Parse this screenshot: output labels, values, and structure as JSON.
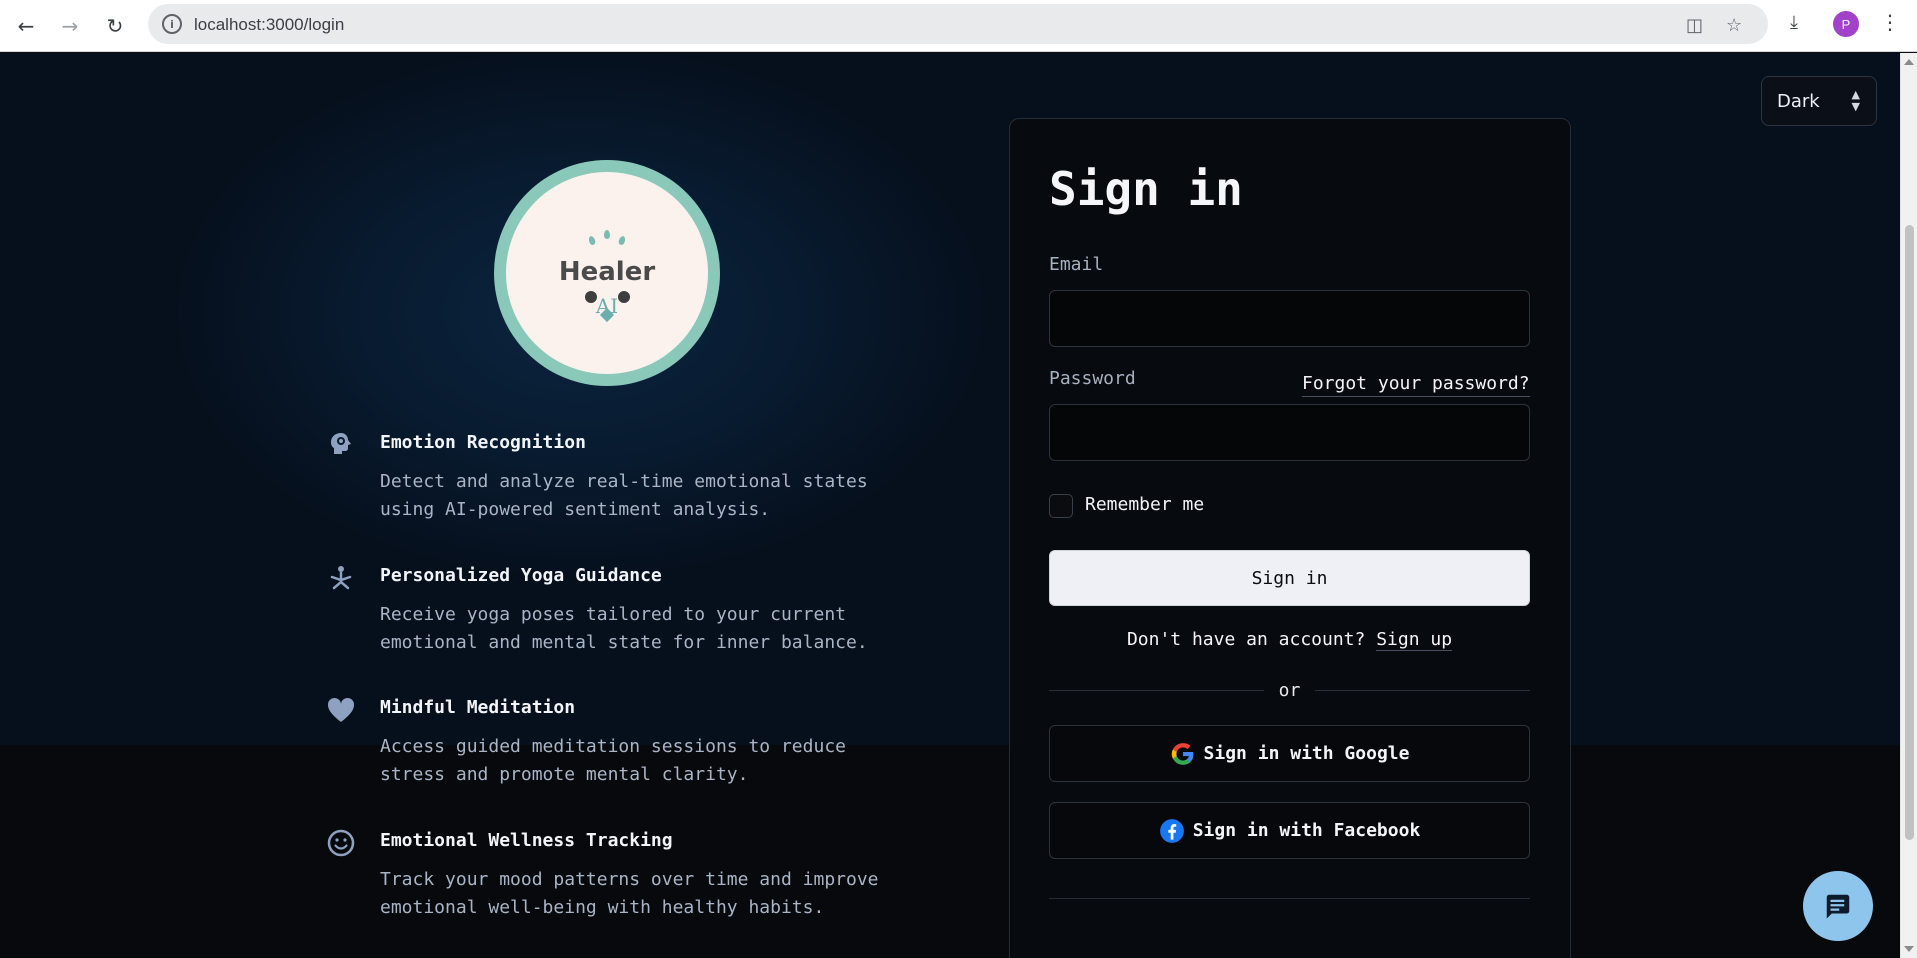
{
  "browser": {
    "url": "localhost:3000/login",
    "profile_initial": "P"
  },
  "theme": {
    "selected": "Dark"
  },
  "brand": {
    "logo_word": "Healer",
    "logo_sub": "AI"
  },
  "features": [
    {
      "icon": "head-gear-icon",
      "title": "Emotion Recognition",
      "desc": "Detect and analyze real-time emotional states using AI-powered sentiment analysis."
    },
    {
      "icon": "yoga-pose-icon",
      "title": "Personalized Yoga Guidance",
      "desc": "Receive yoga poses tailored to your current emotional and mental state for inner balance."
    },
    {
      "icon": "heart-icon",
      "title": "Mindful Meditation",
      "desc": "Access guided meditation sessions to reduce stress and promote mental clarity."
    },
    {
      "icon": "smiley-icon",
      "title": "Emotional Wellness Tracking",
      "desc": "Track your mood patterns over time and improve emotional well-being with healthy habits."
    }
  ],
  "signin": {
    "title": "Sign in",
    "email_label": "Email",
    "email_value": "",
    "password_label": "Password",
    "password_value": "",
    "forgot_link": "Forgot your password?",
    "remember_label": "Remember me",
    "submit_label": "Sign in",
    "no_account_text": "Don't have an account?",
    "signup_link": "Sign up",
    "divider_text": "or",
    "google_label": "Sign in with Google",
    "facebook_label": "Sign in with Facebook"
  },
  "colors": {
    "logo_ring": "#8ac8b9",
    "logo_fill": "#fbf2ee",
    "chat_fab": "#8ec5ec",
    "facebook_blue": "#1877f2"
  }
}
